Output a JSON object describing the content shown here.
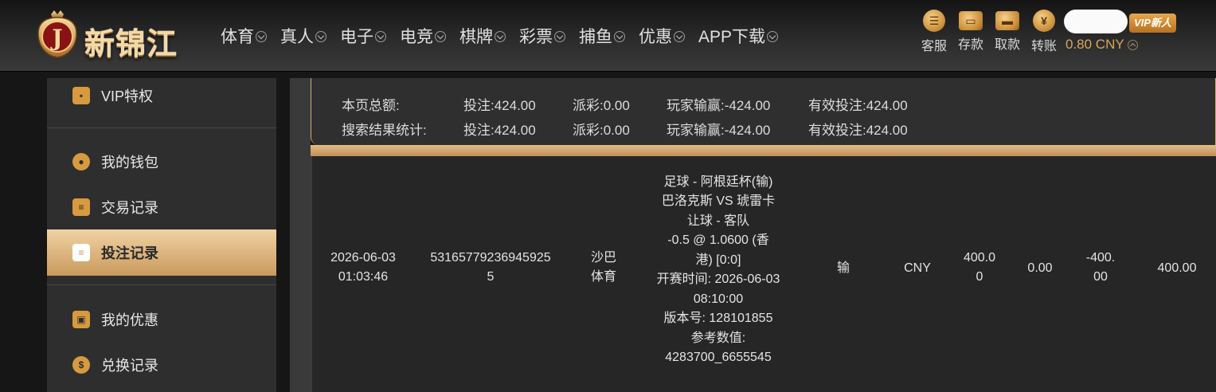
{
  "header": {
    "logo_text": "新锦江",
    "nav": [
      {
        "label": "体育"
      },
      {
        "label": "真人"
      },
      {
        "label": "电子"
      },
      {
        "label": "电竞"
      },
      {
        "label": "棋牌"
      },
      {
        "label": "彩票"
      },
      {
        "label": "捕鱼"
      },
      {
        "label": "优惠"
      },
      {
        "label": "APP下载"
      }
    ],
    "tools": [
      {
        "label": "客服",
        "icon": "chat-icon"
      },
      {
        "label": "存款",
        "icon": "wallet-icon"
      },
      {
        "label": "取款",
        "icon": "card-icon"
      },
      {
        "label": "转账",
        "icon": "yen-icon"
      }
    ],
    "vip_badge": "VIP新人",
    "balance": "0.80 CNY"
  },
  "sidebar": {
    "items": [
      {
        "label": "VIP特权",
        "icon": "id-card-icon"
      },
      {
        "label": "我的钱包",
        "icon": "piggy-bank-icon"
      },
      {
        "label": "交易记录",
        "icon": "document-icon"
      },
      {
        "label": "投注记录",
        "icon": "bet-slip-icon"
      },
      {
        "label": "我的优惠",
        "icon": "gift-bag-icon"
      },
      {
        "label": "兑换记录",
        "icon": "money-bag-icon"
      }
    ],
    "active": "投注记录"
  },
  "summary": {
    "rows": [
      {
        "title": "本页总额:",
        "bet": "投注:424.00",
        "payout": "派彩:0.00",
        "winloss": "玩家输赢:-424.00",
        "valid": "有效投注:424.00"
      },
      {
        "title": "搜索结果统计:",
        "bet": "投注:424.00",
        "payout": "派彩:0.00",
        "winloss": "玩家输赢:-424.00",
        "valid": "有效投注:424.00"
      }
    ]
  },
  "bet_row": {
    "time_line1": "2026-06-03",
    "time_line2": "01:03:46",
    "order_line1": "53165779236945925",
    "order_line2": "5",
    "platform_line1": "沙巴",
    "platform_line2": "体育",
    "details": [
      "足球 - 阿根廷杯(输)",
      "巴洛克斯 VS 琥雷卡",
      "让球 - 客队",
      "-0.5 @ 1.0600 (香",
      "港) [0:0]",
      "开赛时间: 2026-06-03",
      "08:10:00",
      "版本号: 128101855",
      "参考数值:",
      "4283700_6655545"
    ],
    "result": "输",
    "currency": "CNY",
    "bet_amount_line1": "400.0",
    "bet_amount_line2": "0",
    "payout": "0.00",
    "winloss_line1": "-400.",
    "winloss_line2": "00",
    "valid_bet": "400.00"
  }
}
